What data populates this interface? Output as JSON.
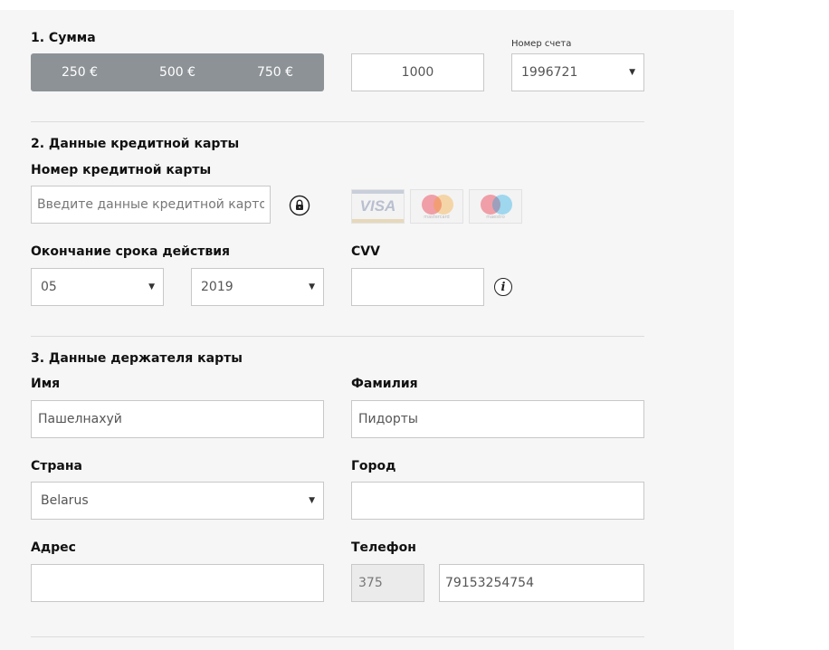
{
  "section1": {
    "title": "1. Сумма",
    "amounts": [
      "250 €",
      "500 €",
      "750 €"
    ],
    "custom_amount": "1000",
    "account_label": "Номер счета",
    "account_value": "1996721"
  },
  "section2": {
    "title": "2. Данные кредитной карты",
    "card_label": "Номер кредитной карты",
    "card_placeholder": "Введите данные кредитной карточки",
    "expiry_label": "Окончание срока действия",
    "expiry_month": "05",
    "expiry_year": "2019",
    "cvv_label": "CVV",
    "card_brands": {
      "visa": "VISA",
      "mastercard": "mastercard",
      "maestro": "maestro"
    }
  },
  "section3": {
    "title": "3. Данные держателя карты",
    "first_name_label": "Имя",
    "first_name_value": "Пашелнахуй",
    "last_name_label": "Фамилия",
    "last_name_value": "Пидорты",
    "country_label": "Страна",
    "country_value": "Belarus",
    "city_label": "Город",
    "city_value": "",
    "address_label": "Адрес",
    "address_value": "",
    "phone_label": "Телефон",
    "phone_code": "375",
    "phone_number": "79153254754"
  },
  "icons": {
    "dropdown": "▼",
    "info": "i"
  },
  "colors": {
    "amount_bar": "#8d9296",
    "panel_bg": "#f6f6f6",
    "field_border": "#c8c8c8",
    "mastercard_red": "#eb001b",
    "mastercard_orange": "#f79e1b",
    "maestro_blue": "#00a2e5"
  }
}
